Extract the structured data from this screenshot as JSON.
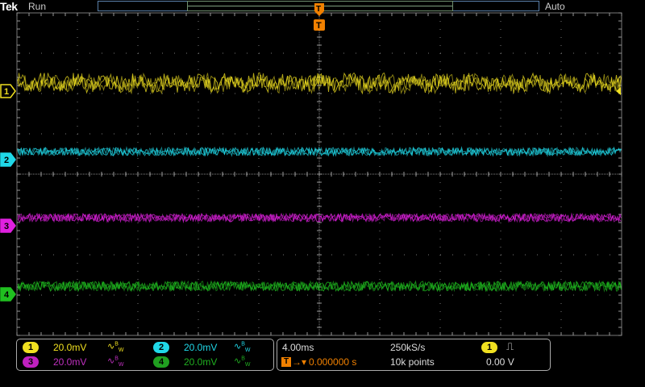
{
  "header": {
    "brand": "Tek",
    "state": "Run",
    "trigger_mode": "Auto",
    "trigger_label": "T"
  },
  "colors": {
    "ch1": "#f0e020",
    "ch2": "#20d8e8",
    "ch3": "#e020e0",
    "ch4": "#20c020",
    "trigger": "#f08000",
    "grid": "#777777"
  },
  "channels": [
    {
      "id": "1",
      "scale": "20.0mV",
      "bw_icon": "bandwidth-limit-icon"
    },
    {
      "id": "2",
      "scale": "20.0mV",
      "bw_icon": "bandwidth-limit-icon"
    },
    {
      "id": "3",
      "scale": "20.0mV",
      "bw_icon": "bandwidth-limit-icon"
    },
    {
      "id": "4",
      "scale": "20.0mV",
      "bw_icon": "bandwidth-limit-icon"
    }
  ],
  "timebase": {
    "scale": "4.00ms",
    "sample_rate": "250kS/s",
    "delay": "0.000000 s",
    "record_length": "10k points"
  },
  "trigger": {
    "source": "1",
    "slope_icon": "rising-edge-icon",
    "level": "0.00 V"
  }
}
